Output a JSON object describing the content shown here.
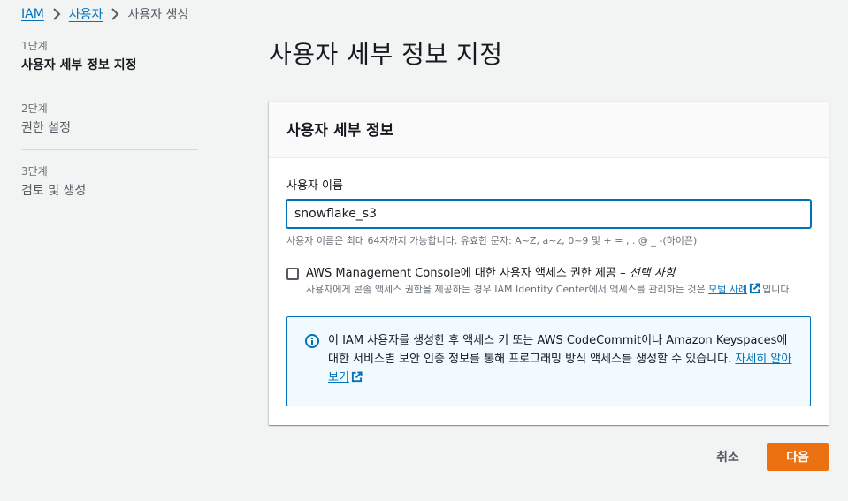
{
  "breadcrumb": {
    "items": [
      "IAM",
      "사용자"
    ],
    "current": "사용자 생성"
  },
  "steps": [
    {
      "num": "1단계",
      "label": "사용자 세부 정보 지정",
      "active": true
    },
    {
      "num": "2단계",
      "label": "권한 설정",
      "active": false
    },
    {
      "num": "3단계",
      "label": "검토 및 생성",
      "active": false
    }
  ],
  "page": {
    "title": "사용자 세부 정보 지정"
  },
  "card": {
    "title": "사용자 세부 정보",
    "username_label": "사용자 이름",
    "username_value": "snowflake_s3",
    "username_hint": "사용자 이름은 최대 64자까지 가능합니다. 유효한 문자: A~Z, a~z, 0~9 및 + = , . @ _ -(하이픈)",
    "console_checkbox": {
      "checked": false,
      "label": "AWS Management Console에 대한 사용자 액세스 권한 제공 – ",
      "optional": "선택 사항",
      "desc_before": "사용자에게 콘솔 액세스 권한을 제공하는 경우 IAM Identity Center에서 액세스를 관리하는 것은 ",
      "desc_link": "모범 사례",
      "desc_after": "입니다."
    },
    "info": {
      "text": "이 IAM 사용자를 생성한 후 액세스 키 또는 AWS CodeCommit이나 Amazon Keyspaces에 대한 서비스별 보안 인증 정보를 통해 프로그래밍 방식 액세스를 생성할 수 있습니다. ",
      "link": "자세히 알아보기"
    }
  },
  "actions": {
    "cancel": "취소",
    "next": "다음"
  },
  "colors": {
    "link": "#0073bb",
    "primary_button": "#ec7211",
    "background": "#f2f3f3",
    "info_bg": "#f1faff"
  }
}
